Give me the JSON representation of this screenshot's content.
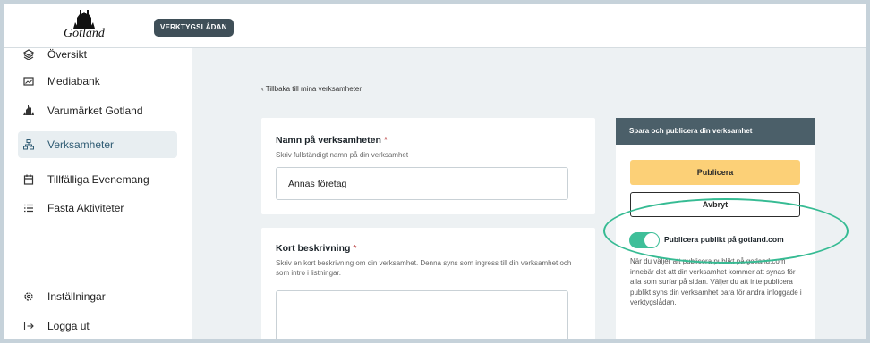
{
  "header": {
    "logo_text": "Gotland",
    "badge": "VERKTYGSLÅDAN"
  },
  "sidebar": {
    "items": [
      {
        "label": "Översikt",
        "icon": "stack-icon"
      },
      {
        "label": "Mediabank",
        "icon": "image-icon"
      },
      {
        "label": "Varumärket Gotland",
        "icon": "gotland-logo-icon"
      },
      {
        "label": "Verksamheter",
        "icon": "sitemap-icon",
        "active": true
      },
      {
        "label": "Tillfälliga Evenemang",
        "icon": "calendar-icon"
      },
      {
        "label": "Fasta Aktiviteter",
        "icon": "list-icon"
      },
      {
        "label": "Inställningar",
        "icon": "gear-icon"
      },
      {
        "label": "Logga ut",
        "icon": "logout-icon"
      }
    ]
  },
  "main": {
    "back_link": "Tillbaka till mina verksamheter",
    "name_field": {
      "title": "Namn på verksamheten",
      "required_mark": "*",
      "help": "Skriv fullständigt namn på din verksamhet",
      "value": "Annas företag"
    },
    "description_field": {
      "title": "Kort beskrivning",
      "required_mark": "*",
      "help": "Skriv en kort beskrivning om din verksamhet. Denna syns som ingress till din verksamhet och som intro i listningar.",
      "value": ""
    }
  },
  "publish_panel": {
    "title": "Spara och publicera din verksamhet",
    "publish_button": "Publicera",
    "cancel_button": "Avbryt",
    "toggle_label": "Publicera publikt på gotland.com",
    "toggle_on": true,
    "description": "När du väljer att publicera publikt på gotland.com innebär det att din verksamhet kommer att synas för alla som surfar på sidan. Väljer du att inte publicera publikt syns din verksamhet bara för andra inloggade i verktygslådan."
  },
  "colors": {
    "accent": "#3fbf99",
    "publish": "#fcd077",
    "panel_header": "#4b5f69",
    "badge": "#3f4f58",
    "annotation": "#36bb93"
  }
}
